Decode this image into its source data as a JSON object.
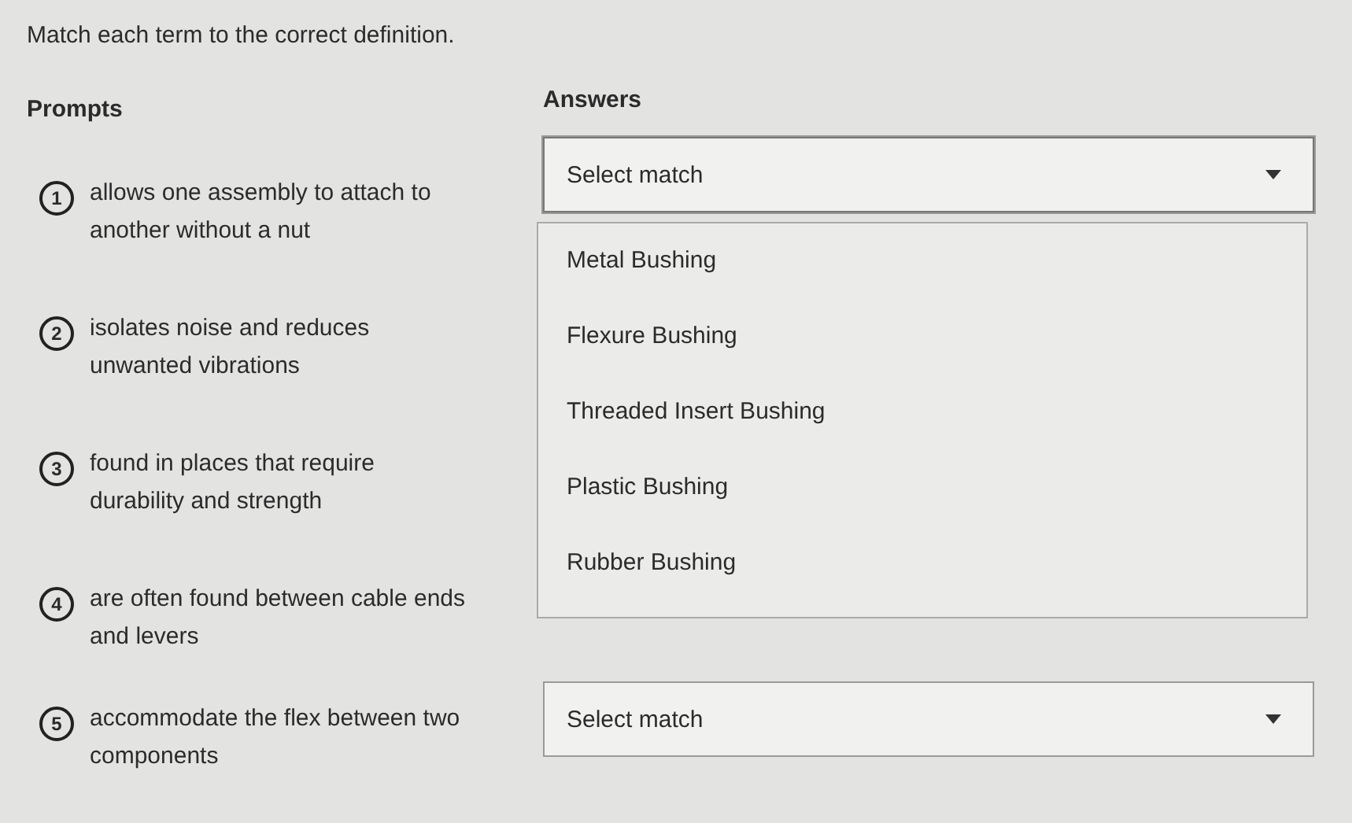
{
  "instruction": "Match each term to the correct definition.",
  "headers": {
    "prompts": "Prompts",
    "answers": "Answers"
  },
  "items": [
    {
      "number": "1",
      "text": "allows one assembly to attach to another without a nut",
      "select": {
        "value": "Select match",
        "expanded": true,
        "options": [
          "Metal Bushing",
          "Flexure Bushing",
          "Threaded Insert Bushing",
          "Plastic Bushing",
          "Rubber Bushing"
        ]
      }
    },
    {
      "number": "2",
      "text": "isolates noise and reduces unwanted vibrations"
    },
    {
      "number": "3",
      "text": "found in places that require durability and strength"
    },
    {
      "number": "4",
      "text": "are often found between cable ends and levers"
    },
    {
      "number": "5",
      "text": "accommodate the flex between two components",
      "select": {
        "value": "Select match",
        "expanded": false
      }
    }
  ]
}
